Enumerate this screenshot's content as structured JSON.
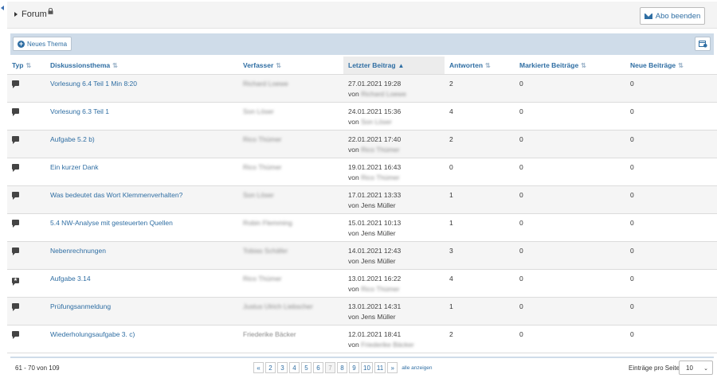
{
  "header": {
    "title": "Forum",
    "abo_label": "Abo beenden"
  },
  "toolbar": {
    "new_topic_label": "Neues Thema"
  },
  "table": {
    "columns": [
      "Typ",
      "Diskussionsthema",
      "Verfasser",
      "Letzter Beitrag",
      "Antworten",
      "Markierte Beiträge",
      "Neue Beiträge"
    ],
    "sorted_column": "Letzter Beitrag",
    "rows": [
      {
        "icon": "chat-icon",
        "topic": "Vorlesung 6.4 Teil 1 Min 8:20",
        "author": "Richard Loewe",
        "date": "27.01.2021 19:28",
        "by_prefix": "von",
        "by": "Richard Loewe",
        "answers": "2",
        "marked": "0",
        "new": "0"
      },
      {
        "icon": "chat-icon",
        "topic": "Vorlesung 6.3 Teil 1",
        "author": "Son Löser",
        "date": "24.01.2021 15:36",
        "by_prefix": "von",
        "by": "Son Löser",
        "answers": "4",
        "marked": "0",
        "new": "0"
      },
      {
        "icon": "chat-icon",
        "topic": "Aufgabe 5.2 b)",
        "author": "Rico Thümer",
        "date": "22.01.2021 17:40",
        "by_prefix": "von",
        "by": "Rico Thümer",
        "answers": "2",
        "marked": "0",
        "new": "0"
      },
      {
        "icon": "chat-icon",
        "topic": "Ein kurzer Dank",
        "author": "Rico Thümer",
        "date": "19.01.2021 16:43",
        "by_prefix": "von",
        "by": "Rico Thümer",
        "answers": "0",
        "marked": "0",
        "new": "0"
      },
      {
        "icon": "chat-icon",
        "topic": "Was bedeutet das Wort Klemmenverhalten?",
        "author": "Son Löser",
        "date": "17.01.2021 13:33",
        "by_prefix": "von",
        "by": "Jens Müller",
        "answers": "1",
        "marked": "0",
        "new": "0"
      },
      {
        "icon": "chat-icon",
        "topic": "5.4 NW-Analyse mit gesteuerten Quellen",
        "author": "Robin Flemming",
        "date": "15.01.2021 10:13",
        "by_prefix": "von",
        "by": "Jens Müller",
        "answers": "1",
        "marked": "0",
        "new": "0"
      },
      {
        "icon": "chat-icon",
        "topic": "Nebenrechnungen",
        "author": "Tobias Schäfer",
        "date": "14.01.2021 12:43",
        "by_prefix": "von",
        "by": "Jens Müller",
        "answers": "3",
        "marked": "0",
        "new": "0"
      },
      {
        "icon": "sticky-chat-icon",
        "topic": "Aufgabe 3.14",
        "author": "Rico Thümer",
        "date": "13.01.2021 16:22",
        "by_prefix": "von",
        "by": "Rico Thümer",
        "answers": "4",
        "marked": "0",
        "new": "0"
      },
      {
        "icon": "chat-icon",
        "topic": "Prüfungsanmeldung",
        "author": "Justus Ulrich Liebscher",
        "date": "13.01.2021 14:31",
        "by_prefix": "von",
        "by": "Jens Müller",
        "answers": "1",
        "marked": "0",
        "new": "0"
      },
      {
        "icon": "chat-icon",
        "topic": "Wiederholungsaufgabe 3. c)",
        "author": "Friederike Bäcker",
        "date": "12.01.2021 18:41",
        "by_prefix": "von",
        "by": "Friederike Bäcker",
        "answers": "2",
        "marked": "0",
        "new": "0"
      }
    ]
  },
  "footer": {
    "range": "61 - 70 von 109",
    "pages": [
      "«",
      "2",
      "3",
      "4",
      "5",
      "6",
      "7",
      "8",
      "9",
      "10",
      "11",
      "»"
    ],
    "current_page": "7",
    "show_all": "alle anzeigen",
    "per_page_label": "Einträge pro Seite:",
    "per_page_value": "10"
  },
  "colors": {
    "link": "#2f6ea3",
    "toolbar_bg": "#cfdce9",
    "row_alt": "#f5f5f5"
  }
}
